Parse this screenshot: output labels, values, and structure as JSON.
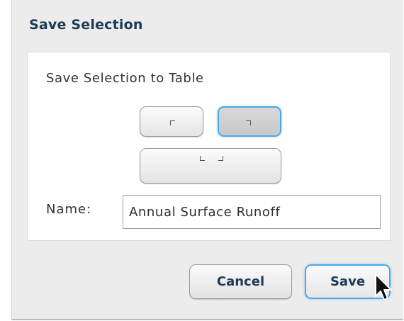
{
  "dialog": {
    "title": "Save Selection",
    "panel_heading": "Save Selection to Table",
    "selection_options": [
      {
        "name": "corner-top-left",
        "selected": false
      },
      {
        "name": "corner-top-right",
        "selected": true
      },
      {
        "name": "corners-bottom",
        "selected": false
      }
    ],
    "name_label": "Name:",
    "name_value": "Annual Surface Runoff",
    "cancel_label": "Cancel",
    "save_label": "Save"
  },
  "colors": {
    "accent": "#4ba8e6",
    "title_text": "#1a3a56",
    "dialog_bg": "#ececec",
    "panel_bg": "#ffffff"
  },
  "icons": [
    "corner-top-left-icon",
    "corner-top-right-icon",
    "corners-bottom-icon",
    "mouse-pointer-icon"
  ]
}
